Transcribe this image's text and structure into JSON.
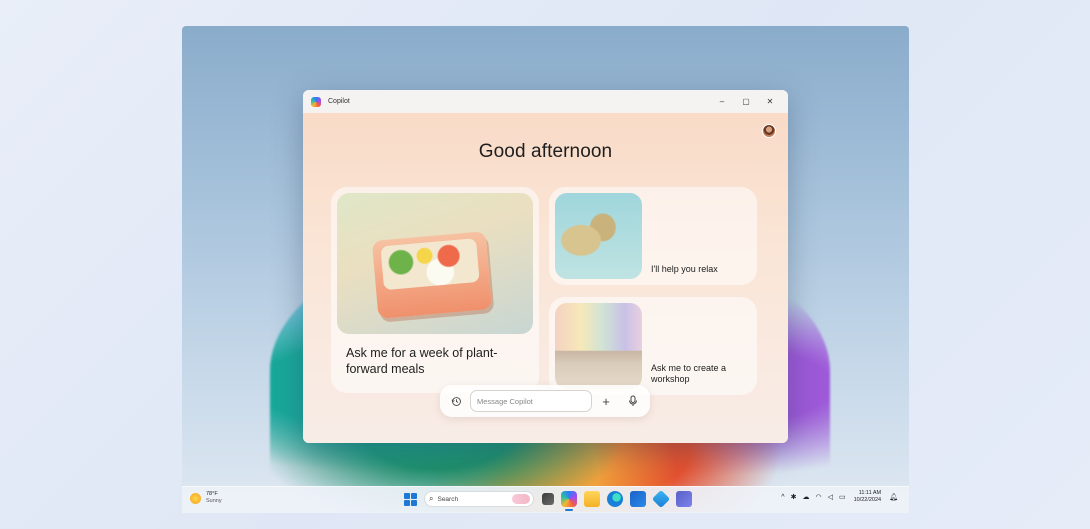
{
  "window": {
    "title": "Copilot",
    "controls": {
      "minimize": "–",
      "maximize": "▢",
      "close": "✕"
    }
  },
  "main": {
    "greeting": "Good afternoon",
    "cards": [
      {
        "label": "Ask me for a week of plant-forward meals"
      },
      {
        "label": "I'll help you relax"
      },
      {
        "label": "Ask me to create a workshop"
      }
    ],
    "composer": {
      "placeholder": "Message Copilot",
      "plus": "+"
    }
  },
  "taskbar": {
    "weather": {
      "temp": "78°F",
      "condition": "Sunny"
    },
    "search_label": "Search",
    "clock": {
      "time": "11:11 AM",
      "date": "10/22/2024"
    },
    "tray_chevron": "^"
  },
  "icons": [
    "copilot-logo",
    "minimize",
    "maximize",
    "close",
    "avatar",
    "history",
    "plus",
    "microphone",
    "weather-sun",
    "windows-start",
    "search",
    "task-view",
    "copilot",
    "file-explorer",
    "edge",
    "microsoft-store",
    "azure",
    "teams",
    "chevron-up",
    "bluetooth",
    "onedrive-cloud",
    "wifi",
    "volume",
    "battery",
    "notification-bell"
  ]
}
